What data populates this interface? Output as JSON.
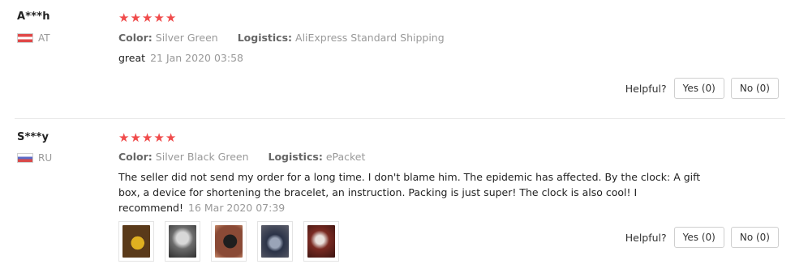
{
  "reviews": [
    {
      "user": "A***h",
      "country": "AT",
      "stars": 5,
      "color_label": "Color:",
      "color_value": "Silver Green",
      "logistics_label": "Logistics:",
      "logistics_value": "AliExpress Standard Shipping",
      "text": "great",
      "date": "21 Jan 2020 03:58",
      "helpful_label": "Helpful?",
      "yes_label": "Yes (0)",
      "no_label": "No (0)"
    },
    {
      "user": "S***y",
      "country": "RU",
      "stars": 5,
      "color_label": "Color:",
      "color_value": "Silver Black Green",
      "logistics_label": "Logistics:",
      "logistics_value": "ePacket",
      "text": "The seller did not send my order for a long time. I don't blame him. The epidemic has affected. By the clock: A gift box, a device for shortening the bracelet, an instruction. Packing is just super! The clock is also cool! I recommend!",
      "date": "16 Mar 2020 07:39",
      "photo_count": 5,
      "helpful_label": "Helpful?",
      "yes_label": "Yes (0)",
      "no_label": "No (0)"
    }
  ],
  "colors": {
    "star": "#f04b4b",
    "muted_text": "#999999",
    "border": "#cfcfcf"
  },
  "icons": {
    "star": "star-icon",
    "flag_at": "austria-flag-icon",
    "flag_ru": "russia-flag-icon"
  }
}
